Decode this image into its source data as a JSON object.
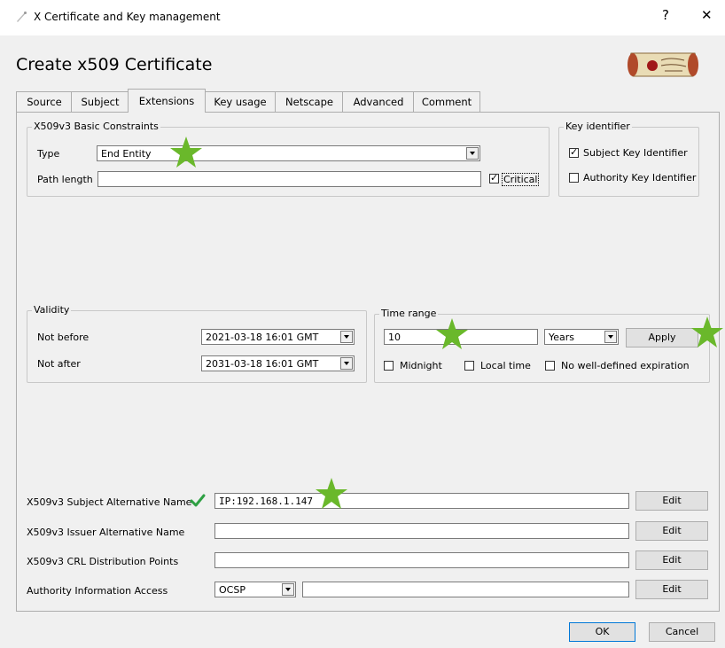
{
  "window": {
    "title": "X Certificate and Key management",
    "help": "?",
    "close": "✕"
  },
  "dialog": {
    "title": "Create x509 Certificate"
  },
  "tabs": [
    "Source",
    "Subject",
    "Extensions",
    "Key usage",
    "Netscape",
    "Advanced",
    "Comment"
  ],
  "active_tab": "Extensions",
  "basic_constraints": {
    "legend": "X509v3 Basic Constraints",
    "type_label": "Type",
    "type_value": "End Entity",
    "path_length_label": "Path length",
    "path_length_value": "",
    "critical_label": "Critical",
    "critical_checked": true
  },
  "key_identifier": {
    "legend": "Key identifier",
    "subject_label": "Subject Key Identifier",
    "subject_checked": true,
    "authority_label": "Authority Key Identifier",
    "authority_checked": false
  },
  "validity": {
    "legend": "Validity",
    "not_before_label": "Not before",
    "not_before_value": "2021-03-18 16:01 GMT",
    "not_after_label": "Not after",
    "not_after_value": "2031-03-18 16:01 GMT"
  },
  "time_range": {
    "legend": "Time range",
    "amount": "10",
    "unit": "Years",
    "apply_label": "Apply",
    "midnight_label": "Midnight",
    "local_time_label": "Local time",
    "no_expiration_label": "No well-defined expiration"
  },
  "extensions": {
    "san_label": "X509v3 Subject Alternative Name",
    "san_value": "IP:192.168.1.147",
    "ian_label": "X509v3 Issuer Alternative Name",
    "ian_value": "",
    "crl_label": "X509v3 CRL Distribution Points",
    "crl_value": "",
    "aia_label": "Authority Information Access",
    "aia_select": "OCSP",
    "aia_value": "",
    "edit_label": "Edit"
  },
  "footer": {
    "ok_label": "OK",
    "cancel_label": "Cancel"
  },
  "colors": {
    "star": "#6ab82b",
    "check": "#2ea043",
    "window_bg": "#f0f0f0"
  }
}
